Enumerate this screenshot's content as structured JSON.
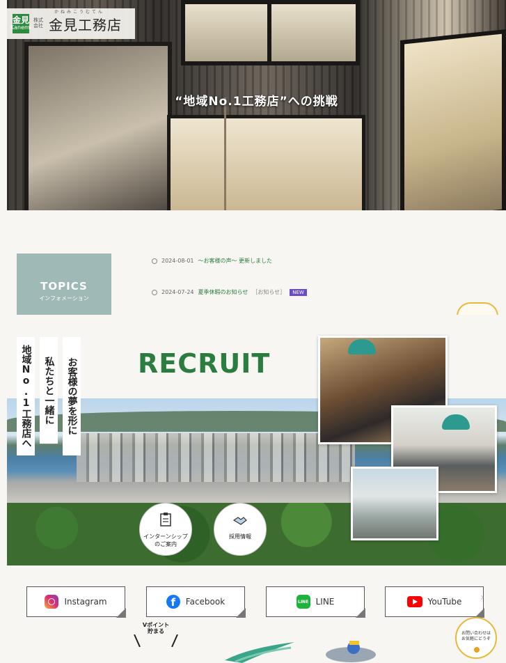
{
  "logo": {
    "mark_letters": "金見",
    "mark_sub": "Kanemi",
    "company_type": "株式会社",
    "name": "金見工務店",
    "ruby": "かねみこうむてん"
  },
  "hero": {
    "title": "“地域No.1工務店”への挑戦"
  },
  "topics": {
    "heading": "TOPICS",
    "subheading": "インフォメーション",
    "items": [
      {
        "date": "2024-08-01",
        "title": "～お客様の声～ 更新しました",
        "category": "",
        "badge": ""
      },
      {
        "date": "2024-07-24",
        "title": "夏季休暇のお知らせ",
        "category": "［お知らせ］",
        "badge": "NEW"
      }
    ]
  },
  "recruit": {
    "title": "RECRUIT",
    "vertical_text": [
      "お客様の夢を形に",
      "私たちと一緒に",
      "地域No.1工務店へ"
    ],
    "buttons": [
      {
        "label_line1": "インターンシップ",
        "label_line2": "のご案内"
      },
      {
        "label_line1": "採用情報",
        "label_line2": ""
      }
    ]
  },
  "social": [
    {
      "name": "Instagram",
      "icon": "instagram-icon"
    },
    {
      "name": "Facebook",
      "icon": "facebook-icon"
    },
    {
      "name": "LINE",
      "icon": "line-icon"
    },
    {
      "name": "YouTube",
      "icon": "youtube-icon"
    }
  ],
  "partners": {
    "vpoint_line1": "Vポイント",
    "vpoint_line2": "貯まる"
  },
  "floating_contact": {
    "line1": "お問い合わせは",
    "line2": "お気軽にどうぞ"
  },
  "colors": {
    "brand_green": "#2b7d3f",
    "topics_box": "#9fb9b6",
    "badge_purple": "#6a4bc9",
    "accent_gold": "#e8b93a"
  }
}
